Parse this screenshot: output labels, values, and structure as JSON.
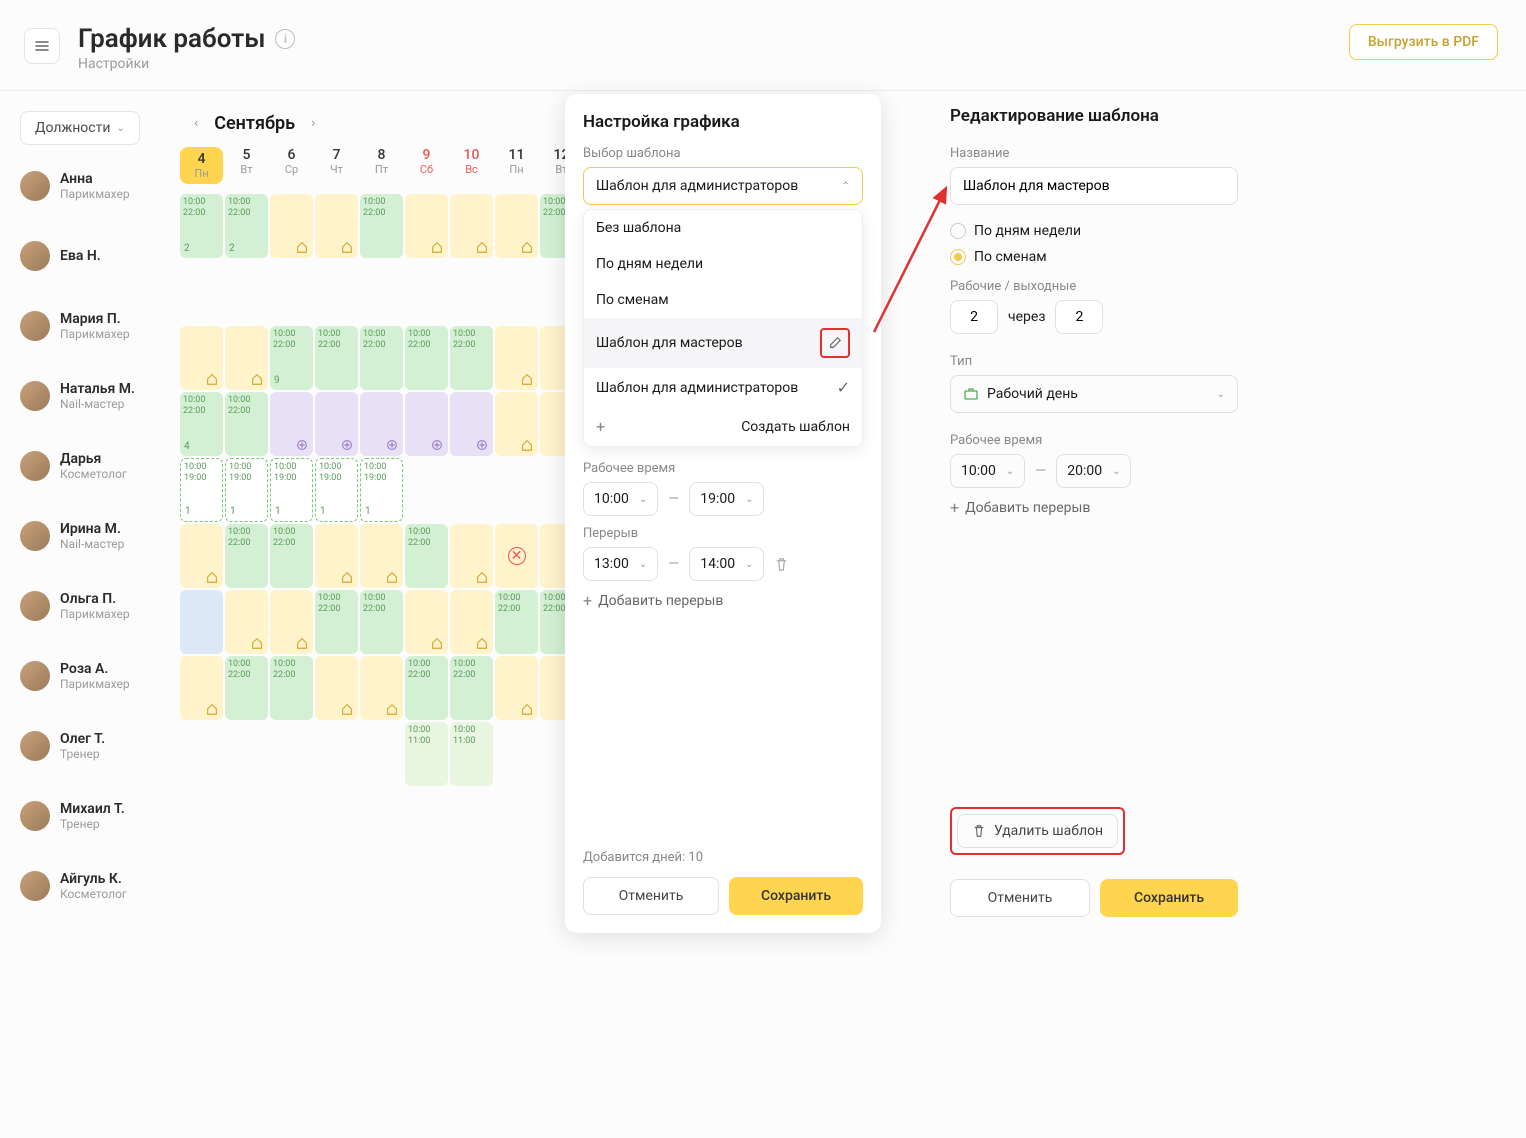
{
  "header": {
    "title": "График работы",
    "subtitle": "Настройки",
    "export": "Выгрузить в PDF"
  },
  "sidebar": {
    "positions": "Должности",
    "staff": [
      {
        "name": "Анна",
        "role": "Парикмахер"
      },
      {
        "name": "Ева Н.",
        "role": ""
      },
      {
        "name": "Мария П.",
        "role": "Парикмахер"
      },
      {
        "name": "Наталья М.",
        "role": "Nail-мастер"
      },
      {
        "name": "Дарья",
        "role": "Косметолог"
      },
      {
        "name": "Ирина М.",
        "role": "Nail-мастер"
      },
      {
        "name": "Ольга П.",
        "role": "Парикмахер"
      },
      {
        "name": "Роза А.",
        "role": "Парикмахер"
      },
      {
        "name": "Олег Т.",
        "role": "Тренер"
      },
      {
        "name": "Михаил Т.",
        "role": "Тренер"
      },
      {
        "name": "Айгуль К.",
        "role": "Косметолог"
      }
    ]
  },
  "calendar": {
    "month": "Сентябрь",
    "days": [
      {
        "n": "4",
        "wd": "Пн",
        "sel": true
      },
      {
        "n": "5",
        "wd": "Вт"
      },
      {
        "n": "6",
        "wd": "Ср"
      },
      {
        "n": "7",
        "wd": "Чт"
      },
      {
        "n": "8",
        "wd": "Пт"
      },
      {
        "n": "9",
        "wd": "Сб",
        "wend": true
      },
      {
        "n": "10",
        "wd": "Вс",
        "wend": true
      },
      {
        "n": "11",
        "wd": "Пн"
      },
      {
        "n": "12",
        "wd": "Вт"
      }
    ],
    "time1": "10:00",
    "time2": "22:00",
    "time3": "10:00",
    "time4": "19:00",
    "time5": "10:00",
    "time6": "11:00",
    "cnt2": "2",
    "cnt1": "1",
    "cnt4": "4",
    "cnt9": "9"
  },
  "panel1": {
    "title": "Настройка графика",
    "template_label": "Выбор шаблона",
    "selected": "Шаблон для администраторов",
    "options": [
      "Без шаблона",
      "По дням недели",
      "По сменам",
      "Шаблон для мастеров",
      "Шаблон для администраторов"
    ],
    "create": "Создать шаблон",
    "worktime_label": "Рабочее время",
    "work_from": "10:00",
    "work_to": "19:00",
    "break_label": "Перерыв",
    "break_from": "13:00",
    "break_to": "14:00",
    "add_break": "Добавить перерыв",
    "days_added": "Добавится дней: 10",
    "cancel": "Отменить",
    "save": "Сохранить"
  },
  "panel2": {
    "title": "Редактирование шаблона",
    "name_label": "Название",
    "name_value": "Шаблон для мастеров",
    "by_weekdays": "По дням недели",
    "by_shifts": "По сменам",
    "ratio_label": "Рабочие / выходные",
    "ratio_a": "2",
    "ratio_b": "2",
    "through": "через",
    "type_label": "Тип",
    "type_value": "Рабочий день",
    "worktime_label": "Рабочее время",
    "work_from": "10:00",
    "work_to": "20:00",
    "add_break": "Добавить перерыв",
    "delete": "Удалить шаблон",
    "cancel": "Отменить",
    "save": "Сохранить"
  }
}
